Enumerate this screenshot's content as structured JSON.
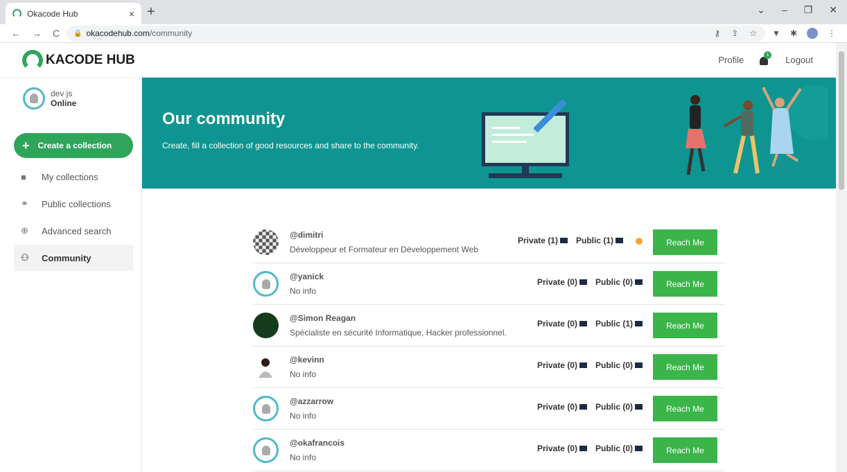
{
  "browser": {
    "tab_title": "Okacode Hub",
    "tab_close": "×",
    "new_tab": "+",
    "url_domain": "okacodehub.com",
    "url_path": "/community"
  },
  "header": {
    "logo_text": "KACODE HUB",
    "profile_label": "Profile",
    "notification_count": "1",
    "logout_label": "Logout"
  },
  "sidebar": {
    "user_name": "dev js",
    "user_status": "Online",
    "create_label": "Create a collection",
    "items": [
      {
        "label": "My collections",
        "icon": "folder-icon"
      },
      {
        "label": "Public collections",
        "icon": "share-icon"
      },
      {
        "label": "Advanced search",
        "icon": "search-icon"
      },
      {
        "label": "Community",
        "icon": "users-icon"
      }
    ]
  },
  "banner": {
    "title": "Our community",
    "subtitle": "Create, fill a collection of good resources and share to the community."
  },
  "members": [
    {
      "handle": "@dimitri",
      "bio": "Développeur et Formateur en Développement Web",
      "private": "Private (1)",
      "public": "Public (1)",
      "online": true,
      "reach": "Reach Me"
    },
    {
      "handle": "@yanick",
      "bio": "No info",
      "private": "Private (0)",
      "public": "Public (0)",
      "online": false,
      "reach": "Reach Me"
    },
    {
      "handle": "@Simon Reagan",
      "bio": "Spécialiste en sécurité Informatique, Hacker professionnel.",
      "private": "Private (0)",
      "public": "Public (1)",
      "online": false,
      "reach": "Reach Me"
    },
    {
      "handle": "@kevinn",
      "bio": "No info",
      "private": "Private (0)",
      "public": "Public (0)",
      "online": false,
      "reach": "Reach Me"
    },
    {
      "handle": "@azzarrow",
      "bio": "No info",
      "private": "Private (0)",
      "public": "Public (0)",
      "online": false,
      "reach": "Reach Me"
    },
    {
      "handle": "@okafrancois",
      "bio": "No info",
      "private": "Private (0)",
      "public": "Public (0)",
      "online": false,
      "reach": "Reach Me"
    }
  ],
  "colors": {
    "brand_green": "#2fa55a",
    "banner_teal": "#0e9591",
    "button_green": "#3bb54a",
    "online_dot": "#f4a536"
  }
}
